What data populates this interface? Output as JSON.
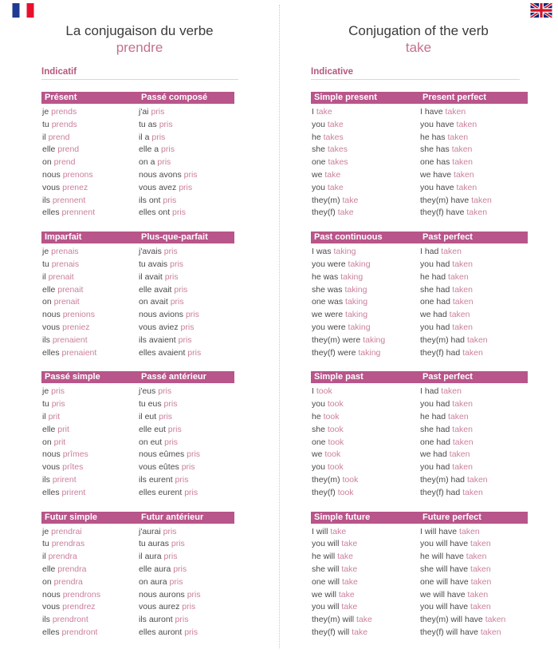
{
  "left": {
    "flag": "french-flag",
    "title_main": "La conjugaison du verbe",
    "title_verb": "prendre",
    "mood": "Indicatif",
    "rows": [
      {
        "columns": [
          {
            "tense": "Présent",
            "forms": [
              {
                "p": "je",
                "v": "prends"
              },
              {
                "p": "tu",
                "v": "prends"
              },
              {
                "p": "il",
                "v": "prend"
              },
              {
                "p": "elle",
                "v": "prend"
              },
              {
                "p": "on",
                "v": "prend"
              },
              {
                "p": "nous",
                "v": "prenons"
              },
              {
                "p": "vous",
                "v": "prenez"
              },
              {
                "p": "ils",
                "v": "prennent"
              },
              {
                "p": "elles",
                "v": "prennent"
              }
            ]
          },
          {
            "tense": "Passé composé",
            "forms": [
              {
                "p": "j'ai",
                "v": "pris"
              },
              {
                "p": "tu as",
                "v": "pris"
              },
              {
                "p": "il a",
                "v": "pris"
              },
              {
                "p": "elle a",
                "v": "pris"
              },
              {
                "p": "on a",
                "v": "pris"
              },
              {
                "p": "nous avons",
                "v": "pris"
              },
              {
                "p": "vous avez",
                "v": "pris"
              },
              {
                "p": "ils ont",
                "v": "pris"
              },
              {
                "p": "elles ont",
                "v": "pris"
              }
            ]
          }
        ]
      },
      {
        "columns": [
          {
            "tense": "Imparfait",
            "forms": [
              {
                "p": "je",
                "v": "prenais"
              },
              {
                "p": "tu",
                "v": "prenais"
              },
              {
                "p": "il",
                "v": "prenait"
              },
              {
                "p": "elle",
                "v": "prenait"
              },
              {
                "p": "on",
                "v": "prenait"
              },
              {
                "p": "nous",
                "v": "prenions"
              },
              {
                "p": "vous",
                "v": "preniez"
              },
              {
                "p": "ils",
                "v": "prenaient"
              },
              {
                "p": "elles",
                "v": "prenaient"
              }
            ]
          },
          {
            "tense": "Plus-que-parfait",
            "forms": [
              {
                "p": "j'avais",
                "v": "pris"
              },
              {
                "p": "tu avais",
                "v": "pris"
              },
              {
                "p": "il avait",
                "v": "pris"
              },
              {
                "p": "elle avait",
                "v": "pris"
              },
              {
                "p": "on avait",
                "v": "pris"
              },
              {
                "p": "nous avions",
                "v": "pris"
              },
              {
                "p": "vous aviez",
                "v": "pris"
              },
              {
                "p": "ils avaient",
                "v": "pris"
              },
              {
                "p": "elles avaient",
                "v": "pris"
              }
            ]
          }
        ]
      },
      {
        "columns": [
          {
            "tense": "Passé simple",
            "forms": [
              {
                "p": "je",
                "v": "pris"
              },
              {
                "p": "tu",
                "v": "pris"
              },
              {
                "p": "il",
                "v": "prit"
              },
              {
                "p": "elle",
                "v": "prit"
              },
              {
                "p": "on",
                "v": "prit"
              },
              {
                "p": "nous",
                "v": "prîmes"
              },
              {
                "p": "vous",
                "v": "prîtes"
              },
              {
                "p": "ils",
                "v": "prirent"
              },
              {
                "p": "elles",
                "v": "prirent"
              }
            ]
          },
          {
            "tense": "Passé antérieur",
            "forms": [
              {
                "p": "j'eus",
                "v": "pris"
              },
              {
                "p": "tu eus",
                "v": "pris"
              },
              {
                "p": "il eut",
                "v": "pris"
              },
              {
                "p": "elle eut",
                "v": "pris"
              },
              {
                "p": "on eut",
                "v": "pris"
              },
              {
                "p": "nous eûmes",
                "v": "pris"
              },
              {
                "p": "vous eûtes",
                "v": "pris"
              },
              {
                "p": "ils eurent",
                "v": "pris"
              },
              {
                "p": "elles eurent",
                "v": "pris"
              }
            ]
          }
        ]
      },
      {
        "columns": [
          {
            "tense": "Futur simple",
            "forms": [
              {
                "p": "je",
                "v": "prendrai"
              },
              {
                "p": "tu",
                "v": "prendras"
              },
              {
                "p": "il",
                "v": "prendra"
              },
              {
                "p": "elle",
                "v": "prendra"
              },
              {
                "p": "on",
                "v": "prendra"
              },
              {
                "p": "nous",
                "v": "prendrons"
              },
              {
                "p": "vous",
                "v": "prendrez"
              },
              {
                "p": "ils",
                "v": "prendront"
              },
              {
                "p": "elles",
                "v": "prendront"
              }
            ]
          },
          {
            "tense": "Futur antérieur",
            "forms": [
              {
                "p": "j'aurai",
                "v": "pris"
              },
              {
                "p": "tu auras",
                "v": "pris"
              },
              {
                "p": "il aura",
                "v": "pris"
              },
              {
                "p": "elle aura",
                "v": "pris"
              },
              {
                "p": "on aura",
                "v": "pris"
              },
              {
                "p": "nous aurons",
                "v": "pris"
              },
              {
                "p": "vous aurez",
                "v": "pris"
              },
              {
                "p": "ils auront",
                "v": "pris"
              },
              {
                "p": "elles auront",
                "v": "pris"
              }
            ]
          }
        ]
      }
    ]
  },
  "right": {
    "flag": "union-jack-flag",
    "title_main": "Conjugation of the verb",
    "title_verb": "take",
    "mood": "Indicative",
    "rows": [
      {
        "columns": [
          {
            "tense": "Simple present",
            "forms": [
              {
                "p": "I",
                "v": "take"
              },
              {
                "p": "you",
                "v": "take"
              },
              {
                "p": "he",
                "v": "takes"
              },
              {
                "p": "she",
                "v": "takes"
              },
              {
                "p": "one",
                "v": "takes"
              },
              {
                "p": "we",
                "v": "take"
              },
              {
                "p": "you",
                "v": "take"
              },
              {
                "p": "they(m)",
                "v": "take"
              },
              {
                "p": "they(f)",
                "v": "take"
              }
            ]
          },
          {
            "tense": "Present perfect",
            "forms": [
              {
                "p": "I have",
                "v": "taken"
              },
              {
                "p": "you have",
                "v": "taken"
              },
              {
                "p": "he has",
                "v": "taken"
              },
              {
                "p": "she has",
                "v": "taken"
              },
              {
                "p": "one has",
                "v": "taken"
              },
              {
                "p": "we have",
                "v": "taken"
              },
              {
                "p": "you have",
                "v": "taken"
              },
              {
                "p": "they(m) have",
                "v": "taken"
              },
              {
                "p": "they(f) have",
                "v": "taken"
              }
            ]
          }
        ]
      },
      {
        "columns": [
          {
            "tense": "Past continuous",
            "forms": [
              {
                "p": "I was",
                "v": "taking"
              },
              {
                "p": "you were",
                "v": "taking"
              },
              {
                "p": "he was",
                "v": "taking"
              },
              {
                "p": "she was",
                "v": "taking"
              },
              {
                "p": "one was",
                "v": "taking"
              },
              {
                "p": "we were",
                "v": "taking"
              },
              {
                "p": "you were",
                "v": "taking"
              },
              {
                "p": "they(m) were",
                "v": "taking"
              },
              {
                "p": "they(f) were",
                "v": "taking"
              }
            ]
          },
          {
            "tense": "Past perfect",
            "forms": [
              {
                "p": "I had",
                "v": "taken"
              },
              {
                "p": "you had",
                "v": "taken"
              },
              {
                "p": "he had",
                "v": "taken"
              },
              {
                "p": "she had",
                "v": "taken"
              },
              {
                "p": "one had",
                "v": "taken"
              },
              {
                "p": "we had",
                "v": "taken"
              },
              {
                "p": "you had",
                "v": "taken"
              },
              {
                "p": "they(m) had",
                "v": "taken"
              },
              {
                "p": "they(f) had",
                "v": "taken"
              }
            ]
          }
        ]
      },
      {
        "columns": [
          {
            "tense": "Simple past",
            "forms": [
              {
                "p": "I",
                "v": "took"
              },
              {
                "p": "you",
                "v": "took"
              },
              {
                "p": "he",
                "v": "took"
              },
              {
                "p": "she",
                "v": "took"
              },
              {
                "p": "one",
                "v": "took"
              },
              {
                "p": "we",
                "v": "took"
              },
              {
                "p": "you",
                "v": "took"
              },
              {
                "p": "they(m)",
                "v": "took"
              },
              {
                "p": "they(f)",
                "v": "took"
              }
            ]
          },
          {
            "tense": "Past perfect",
            "forms": [
              {
                "p": "I had",
                "v": "taken"
              },
              {
                "p": "you had",
                "v": "taken"
              },
              {
                "p": "he had",
                "v": "taken"
              },
              {
                "p": "she had",
                "v": "taken"
              },
              {
                "p": "one had",
                "v": "taken"
              },
              {
                "p": "we had",
                "v": "taken"
              },
              {
                "p": "you had",
                "v": "taken"
              },
              {
                "p": "they(m) had",
                "v": "taken"
              },
              {
                "p": "they(f) had",
                "v": "taken"
              }
            ]
          }
        ]
      },
      {
        "columns": [
          {
            "tense": "Simple future",
            "forms": [
              {
                "p": "I will",
                "v": "take"
              },
              {
                "p": "you will",
                "v": "take"
              },
              {
                "p": "he will",
                "v": "take"
              },
              {
                "p": "she will",
                "v": "take"
              },
              {
                "p": "one will",
                "v": "take"
              },
              {
                "p": "we will",
                "v": "take"
              },
              {
                "p": "you will",
                "v": "take"
              },
              {
                "p": "they(m) will",
                "v": "take"
              },
              {
                "p": "they(f) will",
                "v": "take"
              }
            ]
          },
          {
            "tense": "Future perfect",
            "forms": [
              {
                "p": "I will have",
                "v": "taken"
              },
              {
                "p": "you will have",
                "v": "taken"
              },
              {
                "p": "he will have",
                "v": "taken"
              },
              {
                "p": "she will have",
                "v": "taken"
              },
              {
                "p": "one will have",
                "v": "taken"
              },
              {
                "p": "we will have",
                "v": "taken"
              },
              {
                "p": "you will have",
                "v": "taken"
              },
              {
                "p": "they(m) will have",
                "v": "taken"
              },
              {
                "p": "they(f) will have",
                "v": "taken"
              }
            ]
          }
        ]
      }
    ]
  },
  "colors": {
    "tense_header_bg": "#b8558a",
    "verb_text": "#ca7f9c",
    "pronoun_text": "#4a4a4a",
    "mood_label": "#b5587f",
    "title_verb": "#c4708f"
  }
}
